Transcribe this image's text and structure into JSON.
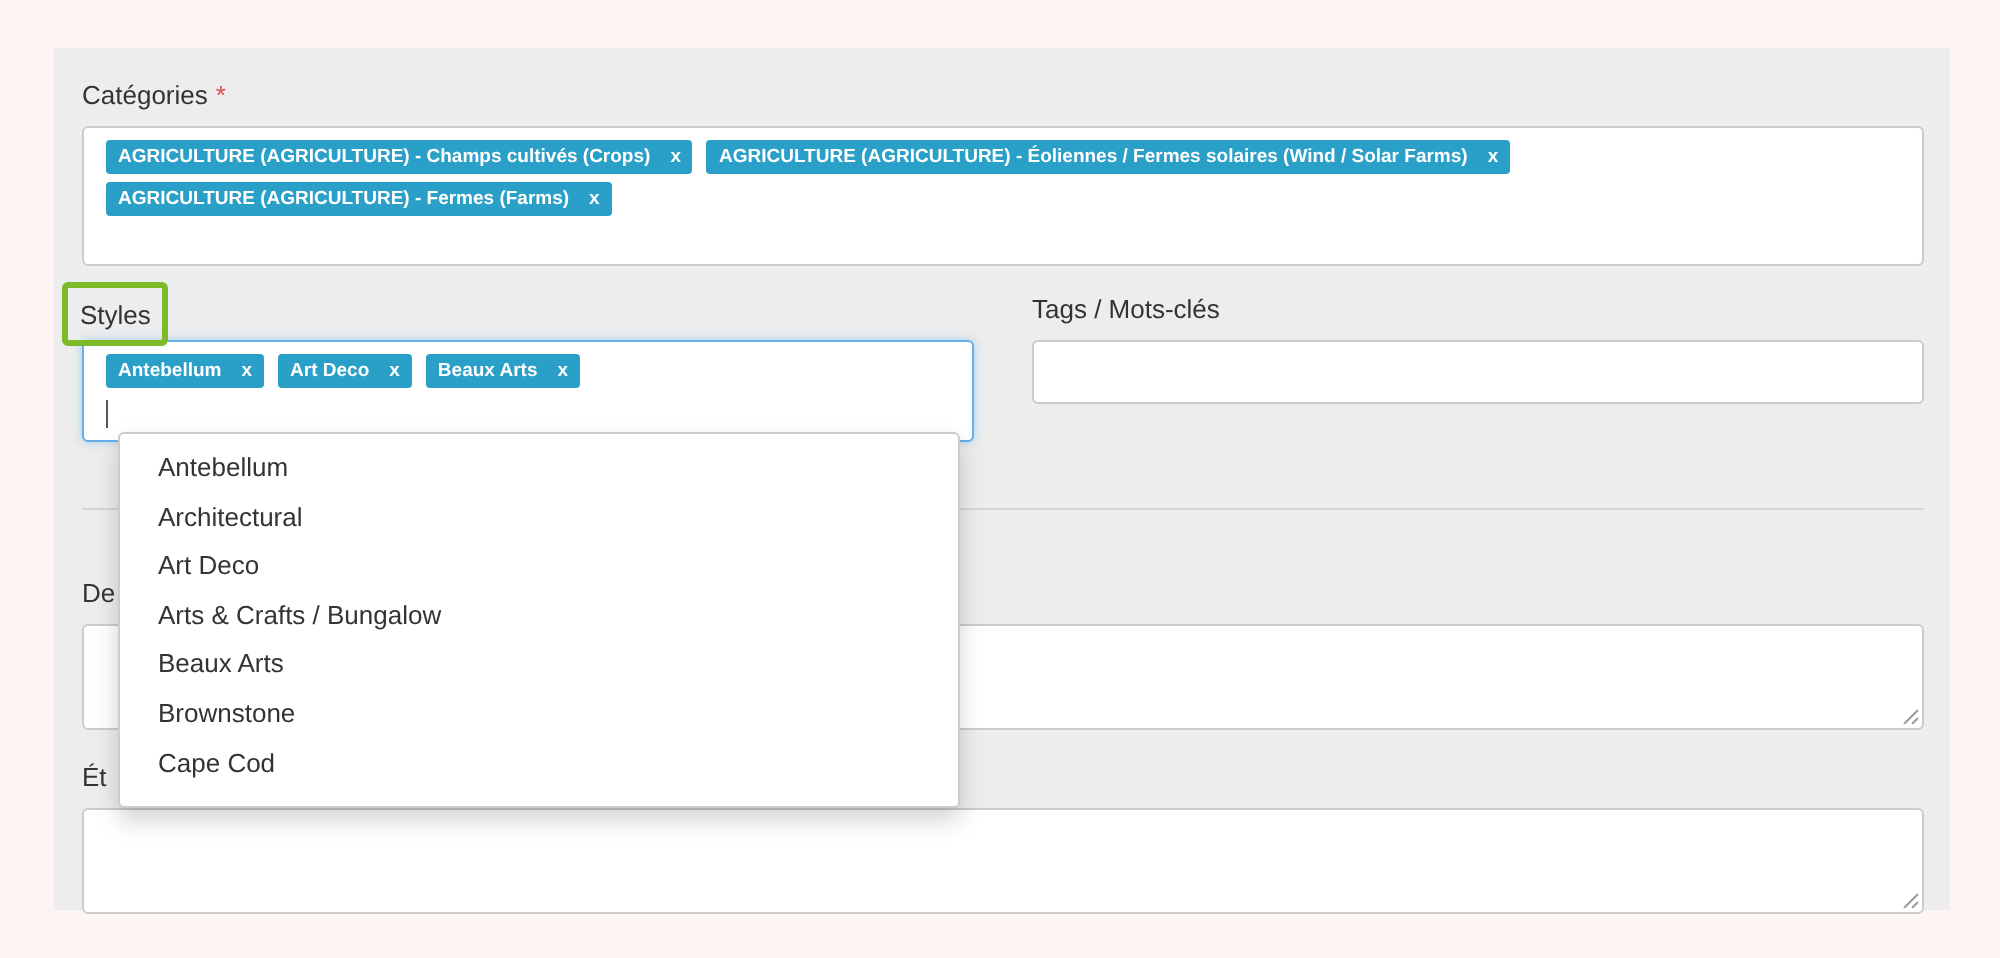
{
  "categories": {
    "label": "Catégories",
    "required_mark": "*",
    "tags": [
      {
        "text": "AGRICULTURE (AGRICULTURE) - Champs cultivés (Crops)",
        "remove": "x"
      },
      {
        "text": "AGRICULTURE (AGRICULTURE) - Éoliennes / Fermes solaires (Wind / Solar Farms)",
        "remove": "x"
      },
      {
        "text": "AGRICULTURE (AGRICULTURE) - Fermes (Farms)",
        "remove": "x"
      }
    ]
  },
  "styles": {
    "label": "Styles",
    "highlighted": true,
    "tags": [
      {
        "text": "Antebellum",
        "remove": "x"
      },
      {
        "text": "Art Deco",
        "remove": "x"
      },
      {
        "text": "Beaux Arts",
        "remove": "x"
      }
    ],
    "options": [
      "Antebellum",
      "Architectural",
      "Art Deco",
      "Arts & Crafts / Bungalow",
      "Beaux Arts",
      "Brownstone",
      "Cape Cod"
    ]
  },
  "tags_field": {
    "label": "Tags / Mots-clés"
  },
  "textareas": [
    {
      "label": "De"
    },
    {
      "label": "Ét"
    }
  ]
}
